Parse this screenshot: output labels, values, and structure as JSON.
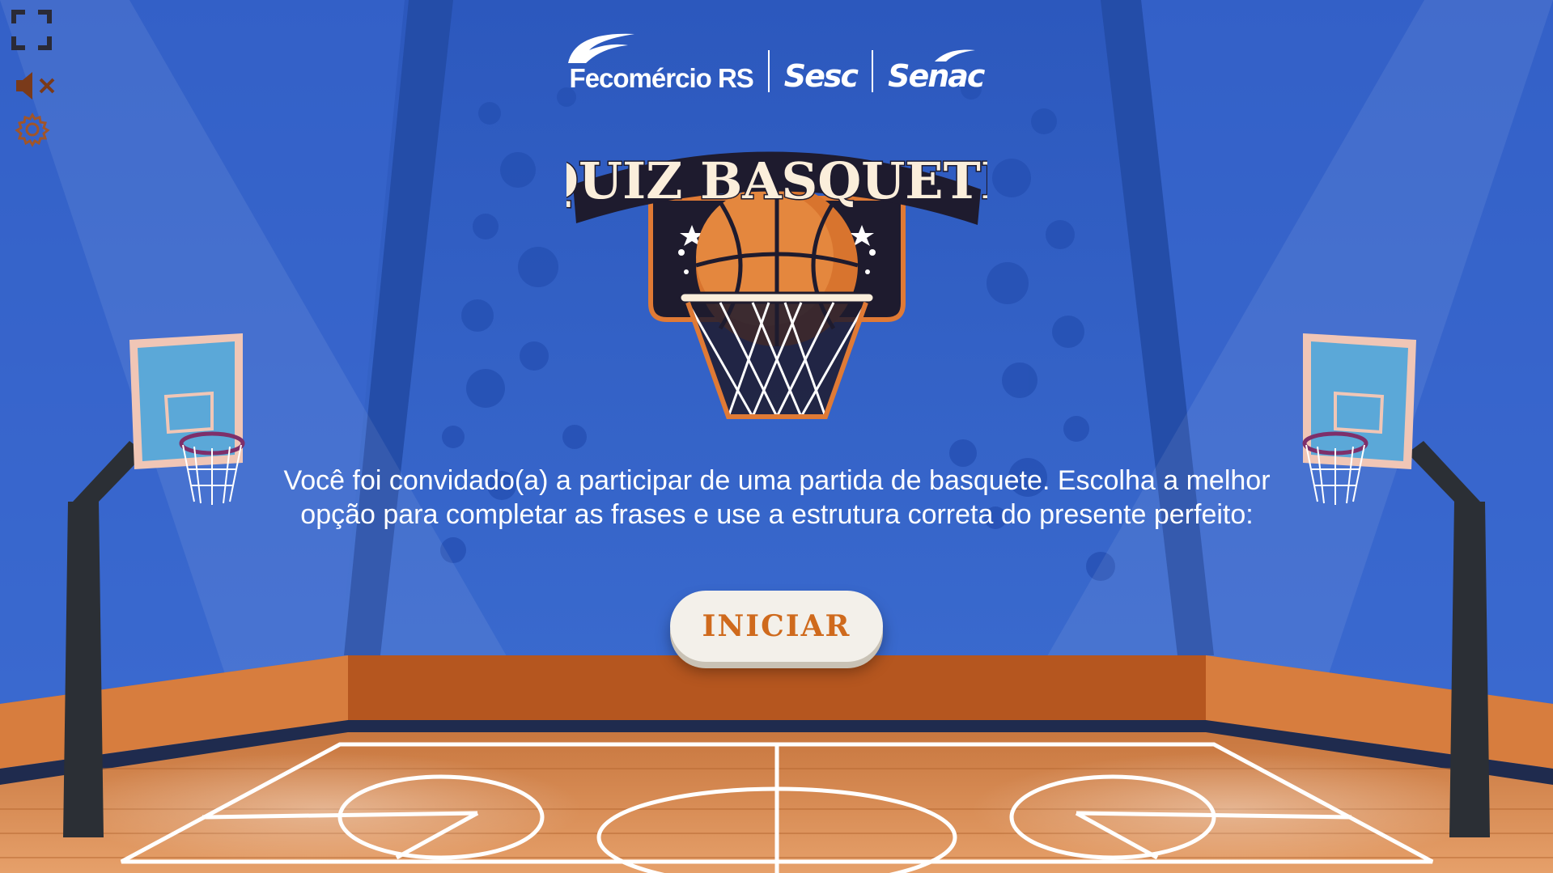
{
  "controls": {
    "fullscreen_icon": "fullscreen-icon",
    "mute_icon": "speaker-muted-icon",
    "settings_icon": "gear-icon"
  },
  "logos": {
    "fecomercio": "Fecomércio RS",
    "sesc": "Sesc",
    "senac": "Senac"
  },
  "title": {
    "line": "QUIZ BASQUETE"
  },
  "intro_text": "Você foi convidado(a) a participar de uma partida de basquete. Escolha a melhor opção para completar as frases e use a estrutura correta do presente perfeito:",
  "start_button": "INICIAR",
  "colors": {
    "wall": "#2f5fc4",
    "floor": "#d98b4c",
    "accent_orange": "#cf6a1d",
    "badge_dark": "#1e1b2e",
    "cream": "#fbeedb"
  }
}
